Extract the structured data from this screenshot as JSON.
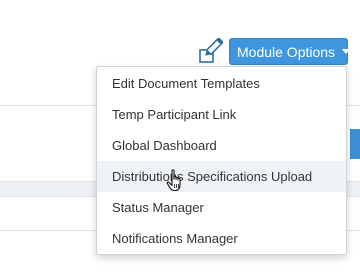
{
  "toolbar": {
    "module_options_label": "Module Options",
    "edit_icon": "pencil-edit-icon"
  },
  "menu": {
    "items": [
      {
        "label": "Edit Document Templates"
      },
      {
        "label": "Temp Participant Link"
      },
      {
        "label": "Global Dashboard"
      },
      {
        "label": "Distributions Specifications Upload"
      },
      {
        "label": "Status Manager"
      },
      {
        "label": "Notifications Manager"
      }
    ],
    "hovered_index": 3
  },
  "colors": {
    "button_bg": "#3e97de",
    "menu_text": "#333333",
    "hover_bg": "#f0f3f5"
  },
  "cursor_icon": "hand-pointer-icon"
}
